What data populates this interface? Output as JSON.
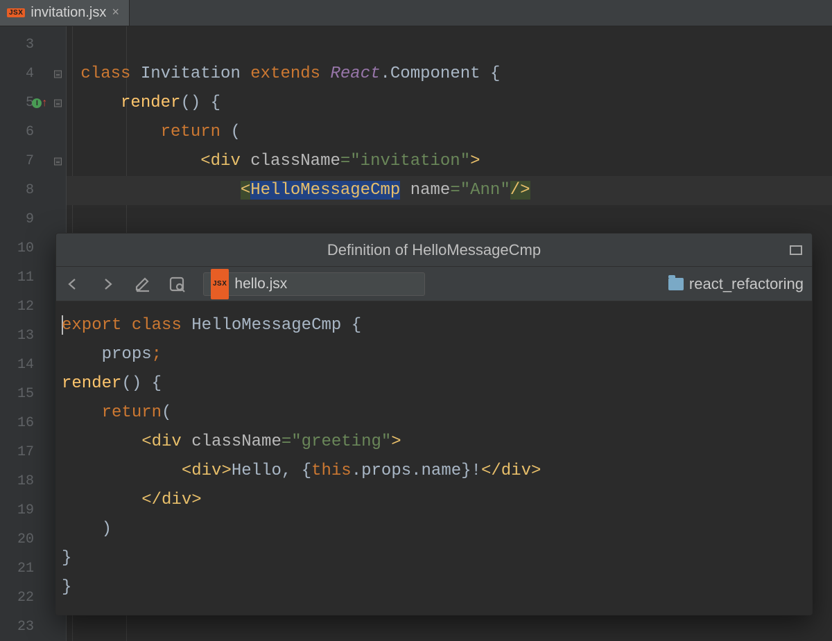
{
  "tab": {
    "badge": "JSX",
    "filename": "invitation.jsx",
    "close": "×"
  },
  "gutter": {
    "start": 3,
    "end": 23
  },
  "code": {
    "l4": {
      "class": "class ",
      "name": "Invitation ",
      "extends": "extends ",
      "react": "React",
      "dot": ".",
      "comp": "Component ",
      "brace": "{"
    },
    "l5": {
      "render": "render",
      "after": "() {"
    },
    "l6": {
      "return": "return ",
      "paren": "("
    },
    "l7": {
      "lt": "<",
      "tag": "div ",
      "attr": "className",
      "eq": "=",
      "val": "\"invitation\"",
      "gt": ">"
    },
    "l8": {
      "lt": "<",
      "tag": "HelloMessageCmp",
      "sp": " ",
      "attr": "name",
      "eq": "=",
      "val": "\"Ann\"",
      "close": "/>"
    }
  },
  "popup": {
    "title": "Definition of HelloMessageCmp",
    "file_badge": "JSX",
    "filename": "hello.jsx",
    "folder": "react_refactoring",
    "body": {
      "l1": {
        "export": "export ",
        "class": "class ",
        "name": "HelloMessageCmp ",
        "brace": "{"
      },
      "l2": {
        "props": "props",
        "semi": ";"
      },
      "l3": {
        "render": "render",
        "after": "() {"
      },
      "l4": {
        "return": "return",
        "paren": "("
      },
      "l5": {
        "lt": "<",
        "tag": "div ",
        "attr": "className",
        "eq": "=",
        "val": "\"greeting\"",
        "gt": ">"
      },
      "l6": {
        "lt": "<",
        "tag": "div",
        "gt": ">",
        "text": "Hello, ",
        "bo": "{",
        "this": "this",
        "rest": ".props.name",
        "bc": "}",
        "bang": "!",
        "clt": "</",
        "ctag": "div",
        "cgt": ">"
      },
      "l7": {
        "lt": "</",
        "tag": "div",
        "gt": ">"
      },
      "l8": {
        "paren": ")"
      },
      "l9": {
        "brace": "}"
      },
      "l10": {
        "brace": "}"
      }
    }
  }
}
